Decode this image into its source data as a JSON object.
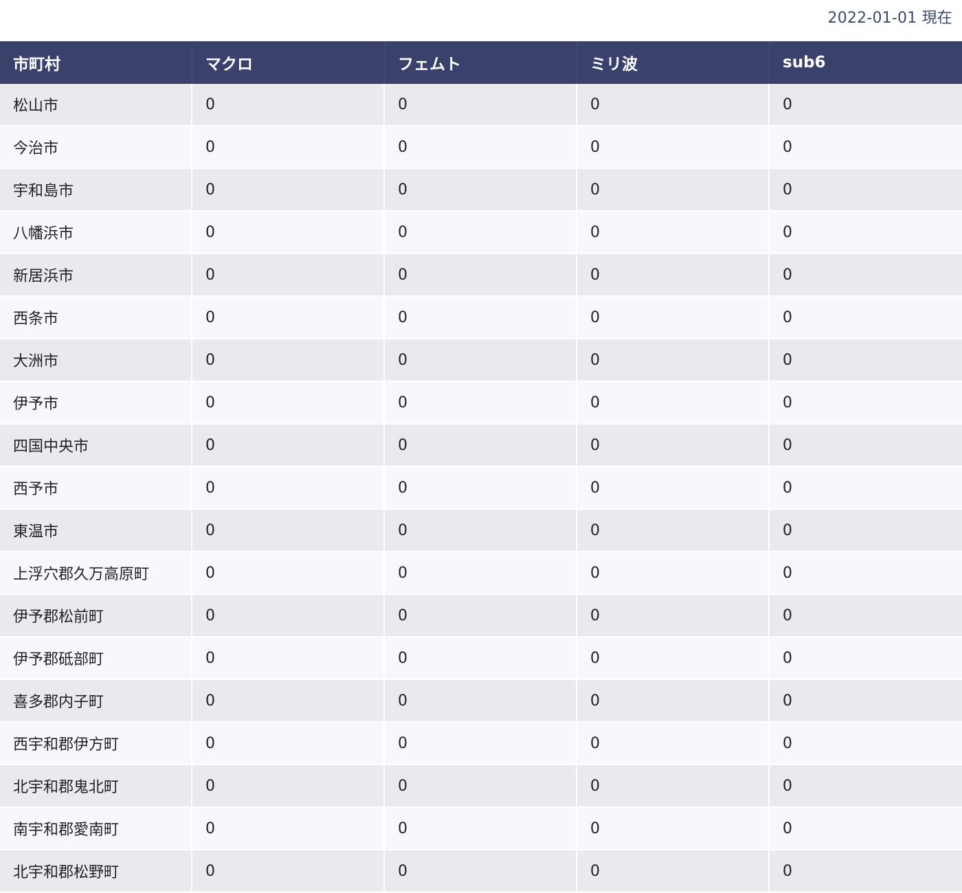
{
  "header": {
    "as_of": "2022-01-01 現在"
  },
  "table": {
    "columns": [
      "市町村",
      "マクロ",
      "フェムト",
      "ミリ波",
      "sub6"
    ],
    "rows": [
      [
        "松山市",
        "0",
        "0",
        "0",
        "0"
      ],
      [
        "今治市",
        "0",
        "0",
        "0",
        "0"
      ],
      [
        "宇和島市",
        "0",
        "0",
        "0",
        "0"
      ],
      [
        "八幡浜市",
        "0",
        "0",
        "0",
        "0"
      ],
      [
        "新居浜市",
        "0",
        "0",
        "0",
        "0"
      ],
      [
        "西条市",
        "0",
        "0",
        "0",
        "0"
      ],
      [
        "大洲市",
        "0",
        "0",
        "0",
        "0"
      ],
      [
        "伊予市",
        "0",
        "0",
        "0",
        "0"
      ],
      [
        "四国中央市",
        "0",
        "0",
        "0",
        "0"
      ],
      [
        "西予市",
        "0",
        "0",
        "0",
        "0"
      ],
      [
        "東温市",
        "0",
        "0",
        "0",
        "0"
      ],
      [
        "上浮穴郡久万高原町",
        "0",
        "0",
        "0",
        "0"
      ],
      [
        "伊予郡松前町",
        "0",
        "0",
        "0",
        "0"
      ],
      [
        "伊予郡砥部町",
        "0",
        "0",
        "0",
        "0"
      ],
      [
        "喜多郡内子町",
        "0",
        "0",
        "0",
        "0"
      ],
      [
        "西宇和郡伊方町",
        "0",
        "0",
        "0",
        "0"
      ],
      [
        "北宇和郡鬼北町",
        "0",
        "0",
        "0",
        "0"
      ],
      [
        "南宇和郡愛南町",
        "0",
        "0",
        "0",
        "0"
      ],
      [
        "北宇和郡松野町",
        "0",
        "0",
        "0",
        "0"
      ]
    ]
  },
  "colors": {
    "header_bg": "#3a416b",
    "row_odd": "#e9eaee",
    "row_even": "#f6f8fc",
    "date_text": "#3a4a6a"
  }
}
